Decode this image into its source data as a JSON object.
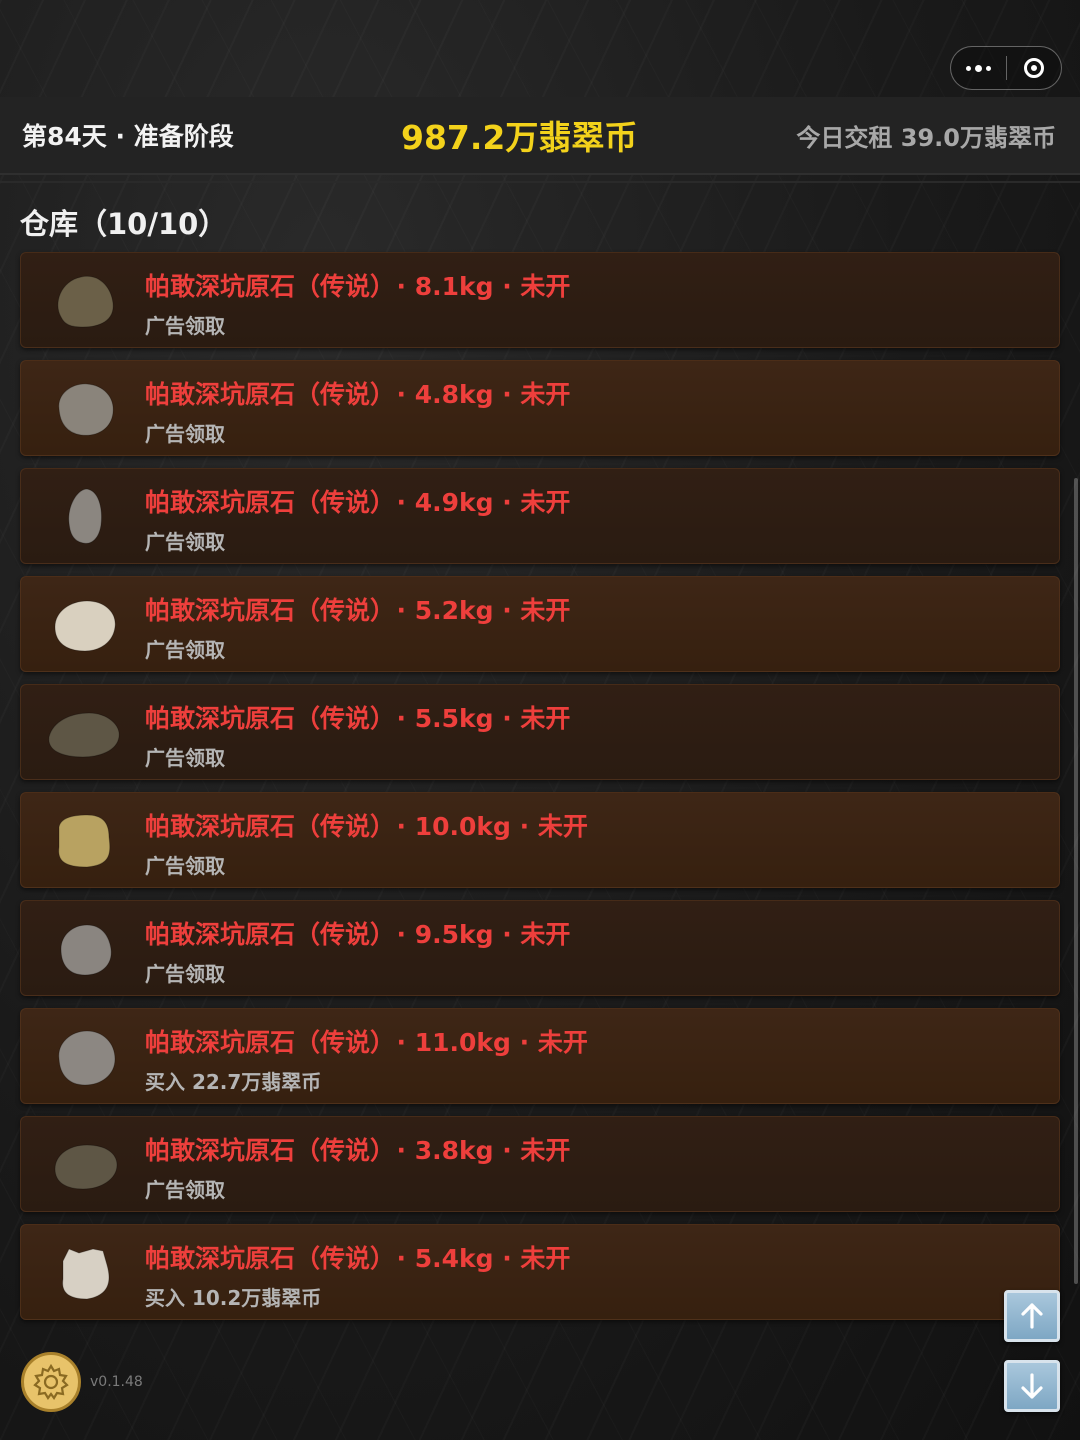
{
  "header": {
    "day_phase": "第84天 · 准备阶段",
    "balance": "987.2万翡翠币",
    "rent": "今日交租  39.0万翡翠币"
  },
  "warehouse": {
    "title": "仓库（10/10）",
    "items": [
      {
        "name": "帕敢深坑原石（传说）",
        "detail": "· 8.1kg · 未开",
        "sub": "广告领取",
        "stone_color": "#6b6048"
      },
      {
        "name": "帕敢深坑原石（传说）",
        "detail": "· 4.8kg · 未开",
        "sub": "广告领取",
        "stone_color": "#8a847b"
      },
      {
        "name": "帕敢深坑原石（传说）",
        "detail": "· 4.9kg · 未开",
        "sub": "广告领取",
        "stone_color": "#8b8680"
      },
      {
        "name": "帕敢深坑原石（传说）",
        "detail": "· 5.2kg · 未开",
        "sub": "广告领取",
        "stone_color": "#d9d0bf"
      },
      {
        "name": "帕敢深坑原石（传说）",
        "detail": "· 5.5kg · 未开",
        "sub": "广告领取",
        "stone_color": "#5e5645"
      },
      {
        "name": "帕敢深坑原石（传说）",
        "detail": "· 10.0kg · 未开",
        "sub": "广告领取",
        "stone_color": "#b8a261"
      },
      {
        "name": "帕敢深坑原石（传说）",
        "detail": "· 9.5kg · 未开",
        "sub": "广告领取",
        "stone_color": "#8a8580"
      },
      {
        "name": "帕敢深坑原石（传说）",
        "detail": "· 11.0kg · 未开",
        "sub": "买入  22.7万翡翠币",
        "stone_color": "#8c8782"
      },
      {
        "name": "帕敢深坑原石（传说）",
        "detail": "· 3.8kg · 未开",
        "sub": "广告领取",
        "stone_color": "#5e5645"
      },
      {
        "name": "帕敢深坑原石（传说）",
        "detail": "· 5.4kg · 未开",
        "sub": "买入  10.2万翡翠币",
        "stone_color": "#d7d0c4"
      }
    ]
  },
  "footer": {
    "version": "v0.1.48"
  },
  "icons": {
    "menu": "more-dots-icon",
    "close": "target-icon",
    "settings": "gear-icon",
    "scroll_up": "arrow-up-icon",
    "scroll_down": "arrow-down-icon"
  },
  "colors": {
    "balance": "#f3d21b",
    "item_title": "#ee3f3c",
    "scroll_button": "#8fb3cc"
  }
}
